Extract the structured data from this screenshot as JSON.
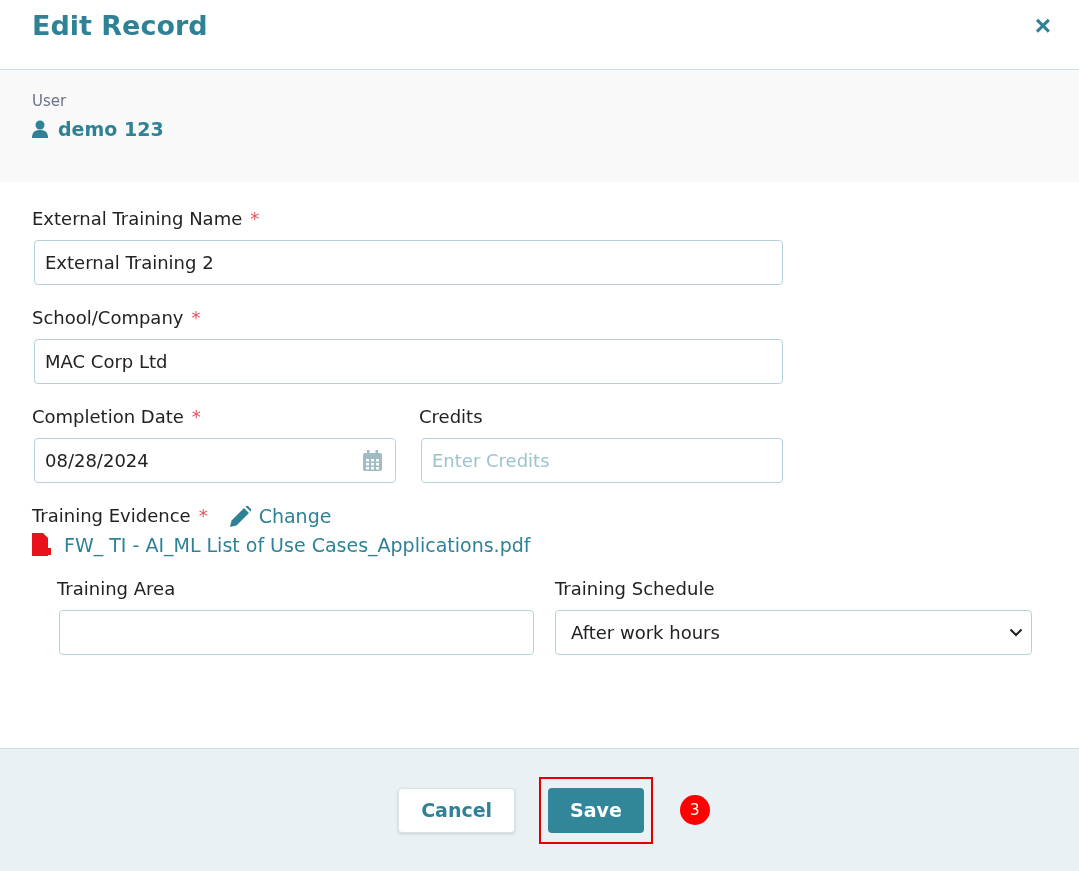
{
  "dialog": {
    "title": "Edit Record",
    "close": "×"
  },
  "user": {
    "label": "User",
    "name": "demo 123"
  },
  "fields": [
    {
      "kind": "text",
      "label": "External Training Name",
      "required": true,
      "value": "External Training 2"
    },
    {
      "kind": "text",
      "label": "School/Company",
      "required": true,
      "value": "MAC Corp Ltd"
    }
  ],
  "pair": [
    {
      "kind": "date",
      "label": "Completion Date",
      "required": true,
      "value": "08/28/2024"
    },
    {
      "kind": "text",
      "label": "Credits",
      "required": false,
      "placeholder": "Enter Credits"
    }
  ],
  "evidence": {
    "label": "Training Evidence",
    "required": true,
    "action": "Change",
    "file": "FW_ TI - AI_ML List of Use Cases_Applications.pdf"
  },
  "extra": [
    {
      "kind": "text",
      "label": "Training Area"
    },
    {
      "kind": "select",
      "label": "Training Schedule",
      "value": "After work hours"
    }
  ],
  "buttons": [
    {
      "label": "Cancel",
      "kind": "secondary",
      "highlighted": false
    },
    {
      "label": "Save",
      "kind": "primary",
      "highlighted": true
    }
  ],
  "step_badge": "3",
  "required_mark": "*"
}
